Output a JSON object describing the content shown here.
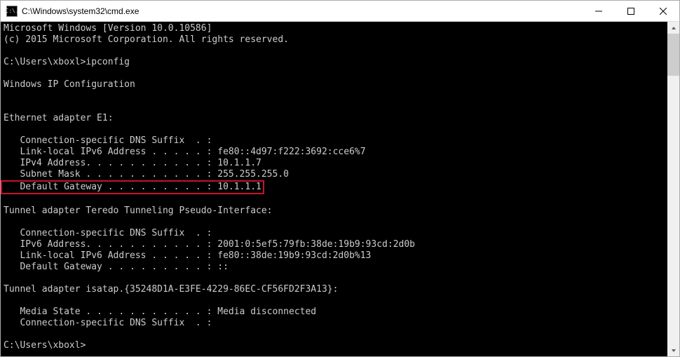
{
  "window": {
    "icon_glyph": "C:\\.",
    "title": "C:\\Windows\\system32\\cmd.exe"
  },
  "output": {
    "line1": "Microsoft Windows [Version 10.0.10586]",
    "line2": "(c) 2015 Microsoft Corporation. All rights reserved.",
    "prompt1": "C:\\Users\\xboxl>ipconfig",
    "header": "Windows IP Configuration",
    "adapter1_title": "Ethernet adapter E1:",
    "a1_dns": "   Connection-specific DNS Suffix  . :",
    "a1_llv6": "   Link-local IPv6 Address . . . . . : fe80::4d97:f222:3692:cce6%7",
    "a1_ipv4": "   IPv4 Address. . . . . . . . . . . : 10.1.1.7",
    "a1_mask": "   Subnet Mask . . . . . . . . . . . : 255.255.255.0",
    "a1_gw": "   Default Gateway . . . . . . . . . : 10.1.1.1",
    "adapter2_title": "Tunnel adapter Teredo Tunneling Pseudo-Interface:",
    "a2_dns": "   Connection-specific DNS Suffix  . :",
    "a2_ipv6": "   IPv6 Address. . . . . . . . . . . : 2001:0:5ef5:79fb:38de:19b9:93cd:2d0b",
    "a2_llv6": "   Link-local IPv6 Address . . . . . : fe80::38de:19b9:93cd:2d0b%13",
    "a2_gw": "   Default Gateway . . . . . . . . . : ::",
    "adapter3_title": "Tunnel adapter isatap.{35248D1A-E3FE-4229-86EC-CF56FD2F3A13}:",
    "a3_media": "   Media State . . . . . . . . . . . : Media disconnected",
    "a3_dns": "   Connection-specific DNS Suffix  . :",
    "prompt2": "C:\\Users\\xboxl>"
  }
}
